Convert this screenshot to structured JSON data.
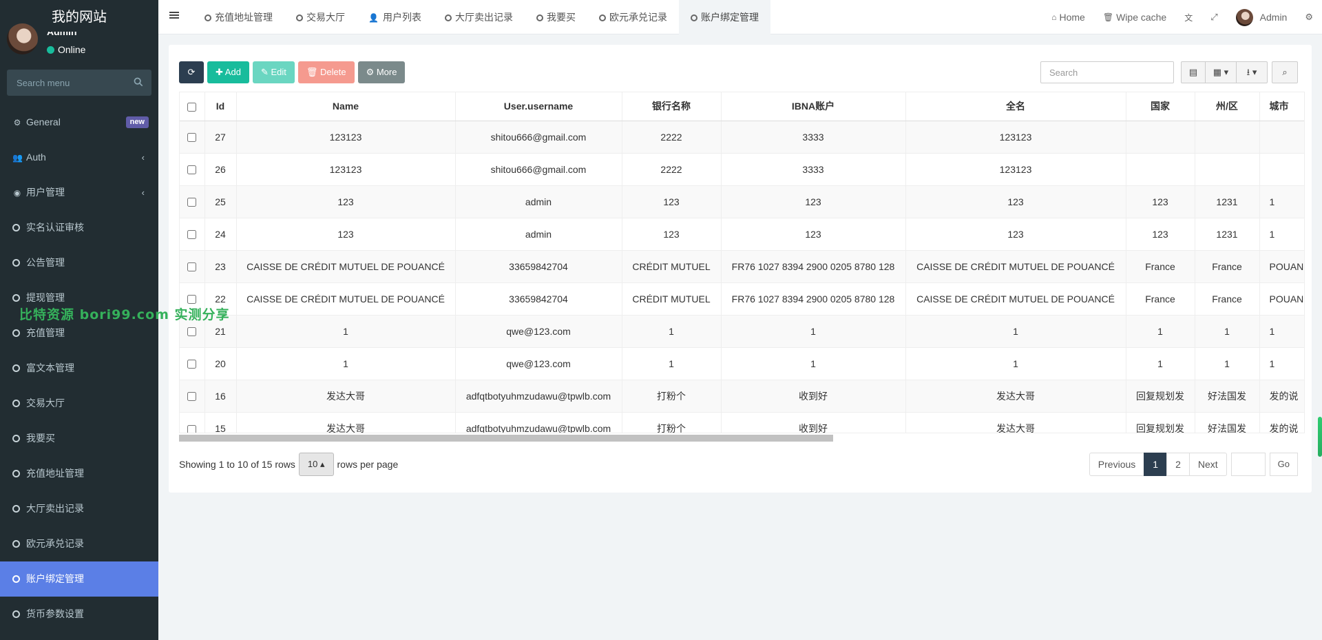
{
  "site_title": "我的网站",
  "user": {
    "name": "Admin",
    "status": "Online"
  },
  "sidebar": {
    "search_placeholder": "Search menu",
    "badge_new": "new",
    "items": [
      {
        "label": "General",
        "icon": "gears-icon"
      },
      {
        "label": "Auth",
        "icon": "users-icon"
      },
      {
        "label": "用户管理",
        "icon": "user-circle-icon"
      },
      {
        "label": "实名认证审核"
      },
      {
        "label": "公告管理"
      },
      {
        "label": "提现管理"
      },
      {
        "label": "充值管理"
      },
      {
        "label": "富文本管理"
      },
      {
        "label": "交易大厅"
      },
      {
        "label": "我要买"
      },
      {
        "label": "充值地址管理"
      },
      {
        "label": "大厅卖出记录"
      },
      {
        "label": "欧元承兑记录"
      },
      {
        "label": "账户绑定管理"
      },
      {
        "label": "货币参数设置"
      }
    ]
  },
  "tabs": [
    "充值地址管理",
    "交易大厅",
    "用户列表",
    "大厅卖出记录",
    "我要买",
    "欧元承兑记录",
    "账户绑定管理"
  ],
  "nav_right": {
    "home": "Home",
    "wipe_cache": "Wipe cache",
    "admin": "Admin"
  },
  "toolbar": {
    "add": "Add",
    "edit": "Edit",
    "delete": "Delete",
    "more": "More",
    "search_placeholder": "Search"
  },
  "table": {
    "headers": [
      "Id",
      "Name",
      "User.username",
      "银行名称",
      "IBNA账户",
      "全名",
      "国家",
      "州/区",
      "城市"
    ],
    "rows": [
      [
        "27",
        "123123",
        "shitou666@gmail.com",
        "2222",
        "3333",
        "123123",
        "",
        "",
        ""
      ],
      [
        "26",
        "123123",
        "shitou666@gmail.com",
        "2222",
        "3333",
        "123123",
        "",
        "",
        ""
      ],
      [
        "25",
        "123",
        "admin",
        "123",
        "123",
        "123",
        "123",
        "1231",
        "1"
      ],
      [
        "24",
        "123",
        "admin",
        "123",
        "123",
        "123",
        "123",
        "1231",
        "1"
      ],
      [
        "23",
        "CAISSE DE CRÉDIT MUTUEL DE POUANCÉ",
        "33659842704",
        "CRÉDIT MUTUEL",
        "FR76 1027 8394 2900 0205 8780 128",
        "CAISSE DE CRÉDIT MUTUEL DE POUANCÉ",
        "France",
        "France",
        "POUANCÉ"
      ],
      [
        "22",
        "CAISSE DE CRÉDIT MUTUEL DE POUANCÉ",
        "33659842704",
        "CRÉDIT MUTUEL",
        "FR76 1027 8394 2900 0205 8780 128",
        "CAISSE DE CRÉDIT MUTUEL DE POUANCÉ",
        "France",
        "France",
        "POUANCÉ"
      ],
      [
        "21",
        "1",
        "qwe@123.com",
        "1",
        "1",
        "1",
        "1",
        "1",
        "1"
      ],
      [
        "20",
        "1",
        "qwe@123.com",
        "1",
        "1",
        "1",
        "1",
        "1",
        "1"
      ],
      [
        "16",
        "发达大哥",
        "adfqtbotyuhmzudawu@tpwlb.com",
        "打粉个",
        "收到好",
        "发达大哥",
        "回复规划发",
        "好法国发",
        "发的说"
      ],
      [
        "15",
        "发达大哥",
        "adfqtbotyuhmzudawu@tpwlb.com",
        "打粉个",
        "收到好",
        "发达大哥",
        "回复规划发",
        "好法国发",
        "发的说"
      ]
    ]
  },
  "pagination": {
    "showing": "Showing 1 to 10 of 15 rows",
    "page_size": "10",
    "rows_per_page": "rows per page",
    "previous": "Previous",
    "pages": [
      "1",
      "2"
    ],
    "next": "Next",
    "go": "Go"
  },
  "watermark": "比特资源 bori99.com 实测分享"
}
